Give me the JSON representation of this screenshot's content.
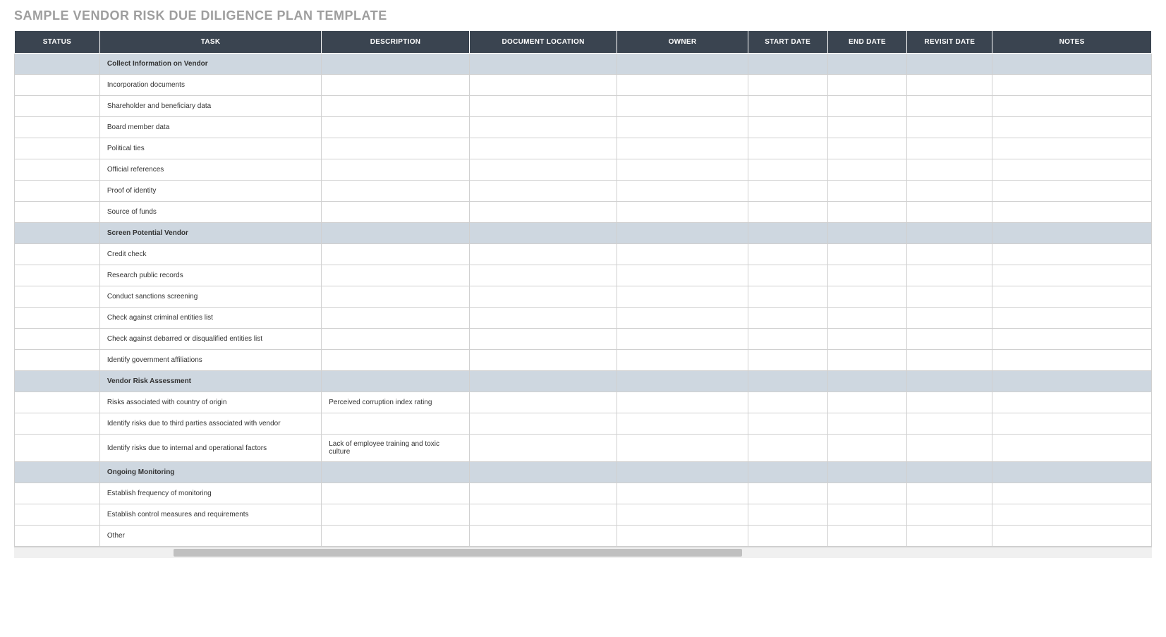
{
  "title": "SAMPLE VENDOR RISK DUE DILIGENCE PLAN TEMPLATE",
  "columns": {
    "status": "STATUS",
    "task": "TASK",
    "description": "DESCRIPTION",
    "doclocation": "DOCUMENT LOCATION",
    "owner": "OWNER",
    "startdate": "START DATE",
    "enddate": "END DATE",
    "revisitdate": "REVISIT DATE",
    "notes": "NOTES"
  },
  "rows": [
    {
      "type": "section",
      "task": "Collect Information on Vendor",
      "description": "",
      "status": "",
      "doclocation": "",
      "owner": "",
      "startdate": "",
      "enddate": "",
      "revisitdate": "",
      "notes": ""
    },
    {
      "type": "item",
      "task": "Incorporation documents",
      "description": "",
      "status": "",
      "doclocation": "",
      "owner": "",
      "startdate": "",
      "enddate": "",
      "revisitdate": "",
      "notes": ""
    },
    {
      "type": "item",
      "task": "Shareholder and beneficiary data",
      "description": "",
      "status": "",
      "doclocation": "",
      "owner": "",
      "startdate": "",
      "enddate": "",
      "revisitdate": "",
      "notes": ""
    },
    {
      "type": "item",
      "task": "Board member data",
      "description": "",
      "status": "",
      "doclocation": "",
      "owner": "",
      "startdate": "",
      "enddate": "",
      "revisitdate": "",
      "notes": ""
    },
    {
      "type": "item",
      "task": "Political ties",
      "description": "",
      "status": "",
      "doclocation": "",
      "owner": "",
      "startdate": "",
      "enddate": "",
      "revisitdate": "",
      "notes": ""
    },
    {
      "type": "item",
      "task": "Official references",
      "description": "",
      "status": "",
      "doclocation": "",
      "owner": "",
      "startdate": "",
      "enddate": "",
      "revisitdate": "",
      "notes": ""
    },
    {
      "type": "item",
      "task": "Proof of identity",
      "description": "",
      "status": "",
      "doclocation": "",
      "owner": "",
      "startdate": "",
      "enddate": "",
      "revisitdate": "",
      "notes": ""
    },
    {
      "type": "item",
      "task": "Source of funds",
      "description": "",
      "status": "",
      "doclocation": "",
      "owner": "",
      "startdate": "",
      "enddate": "",
      "revisitdate": "",
      "notes": ""
    },
    {
      "type": "section",
      "task": "Screen Potential Vendor",
      "description": "",
      "status": "",
      "doclocation": "",
      "owner": "",
      "startdate": "",
      "enddate": "",
      "revisitdate": "",
      "notes": ""
    },
    {
      "type": "item",
      "task": "Credit check",
      "description": "",
      "status": "",
      "doclocation": "",
      "owner": "",
      "startdate": "",
      "enddate": "",
      "revisitdate": "",
      "notes": ""
    },
    {
      "type": "item",
      "task": "Research public records",
      "description": "",
      "status": "",
      "doclocation": "",
      "owner": "",
      "startdate": "",
      "enddate": "",
      "revisitdate": "",
      "notes": ""
    },
    {
      "type": "item",
      "task": "Conduct sanctions screening",
      "description": "",
      "status": "",
      "doclocation": "",
      "owner": "",
      "startdate": "",
      "enddate": "",
      "revisitdate": "",
      "notes": ""
    },
    {
      "type": "item",
      "task": "Check against criminal entities list",
      "description": "",
      "status": "",
      "doclocation": "",
      "owner": "",
      "startdate": "",
      "enddate": "",
      "revisitdate": "",
      "notes": ""
    },
    {
      "type": "item",
      "task": "Check against debarred or disqualified entities list",
      "description": "",
      "status": "",
      "doclocation": "",
      "owner": "",
      "startdate": "",
      "enddate": "",
      "revisitdate": "",
      "notes": ""
    },
    {
      "type": "item",
      "task": "Identify government affiliations",
      "description": "",
      "status": "",
      "doclocation": "",
      "owner": "",
      "startdate": "",
      "enddate": "",
      "revisitdate": "",
      "notes": ""
    },
    {
      "type": "section",
      "task": "Vendor Risk Assessment",
      "description": "",
      "status": "",
      "doclocation": "",
      "owner": "",
      "startdate": "",
      "enddate": "",
      "revisitdate": "",
      "notes": ""
    },
    {
      "type": "item",
      "task": "Risks associated with country of origin",
      "description": "Perceived corruption index rating",
      "status": "",
      "doclocation": "",
      "owner": "",
      "startdate": "",
      "enddate": "",
      "revisitdate": "",
      "notes": ""
    },
    {
      "type": "item",
      "task": "Identify risks due to third parties associated with vendor",
      "description": "",
      "status": "",
      "doclocation": "",
      "owner": "",
      "startdate": "",
      "enddate": "",
      "revisitdate": "",
      "notes": ""
    },
    {
      "type": "item",
      "task": "Identify risks due to internal and operational factors",
      "description": "Lack of employee training and toxic culture",
      "status": "",
      "doclocation": "",
      "owner": "",
      "startdate": "",
      "enddate": "",
      "revisitdate": "",
      "notes": ""
    },
    {
      "type": "section",
      "task": "Ongoing Monitoring",
      "description": "",
      "status": "",
      "doclocation": "",
      "owner": "",
      "startdate": "",
      "enddate": "",
      "revisitdate": "",
      "notes": ""
    },
    {
      "type": "item",
      "task": "Establish frequency of monitoring",
      "description": "",
      "status": "",
      "doclocation": "",
      "owner": "",
      "startdate": "",
      "enddate": "",
      "revisitdate": "",
      "notes": ""
    },
    {
      "type": "item",
      "task": "Establish control measures and requirements",
      "description": "",
      "status": "",
      "doclocation": "",
      "owner": "",
      "startdate": "",
      "enddate": "",
      "revisitdate": "",
      "notes": ""
    },
    {
      "type": "item",
      "task": "Other",
      "description": "",
      "status": "",
      "doclocation": "",
      "owner": "",
      "startdate": "",
      "enddate": "",
      "revisitdate": "",
      "notes": ""
    }
  ]
}
